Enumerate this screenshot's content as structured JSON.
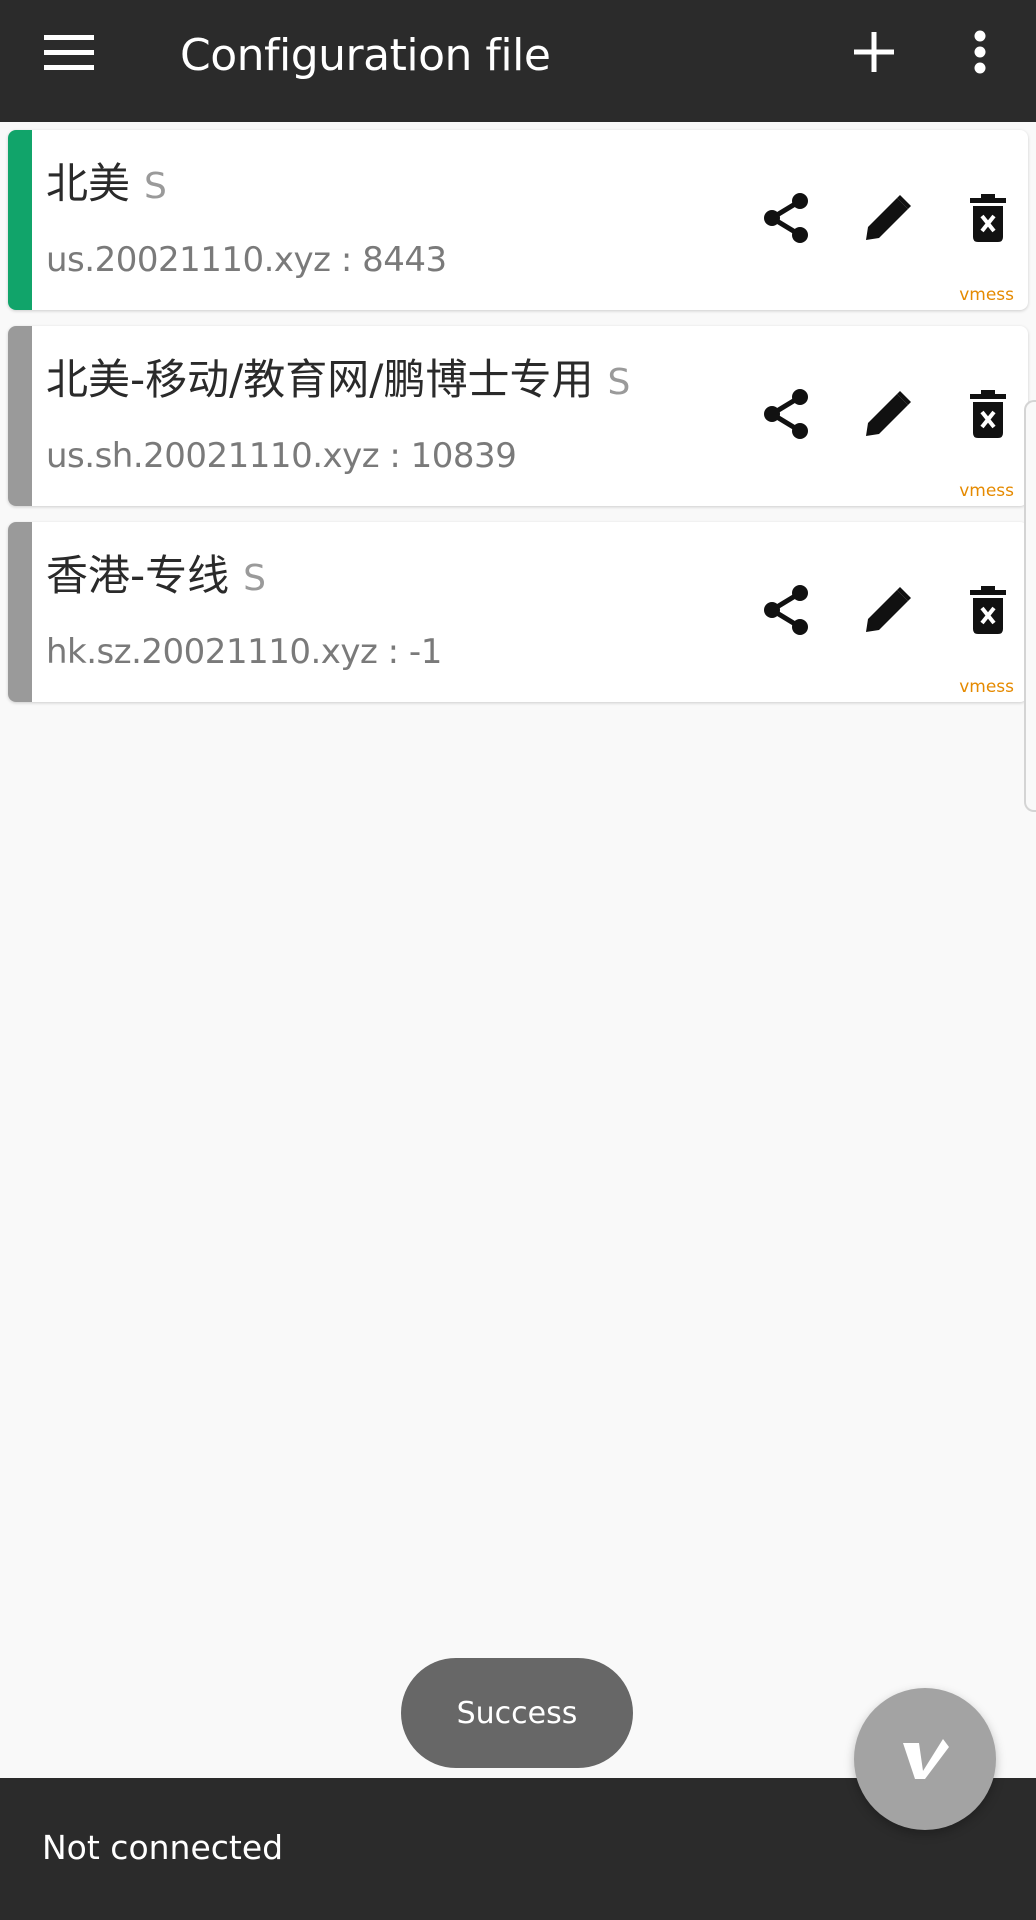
{
  "app_bar": {
    "title": "Configuration file",
    "icons": {
      "menu": "menu-icon",
      "add": "add-icon",
      "more": "more-vert-icon"
    }
  },
  "servers": [
    {
      "name": "北美",
      "suffix": "S",
      "address": "us.20021110.xyz : 8443",
      "protocol": "vmess",
      "selected": true,
      "stripe_color": "#11a46a"
    },
    {
      "name": "北美-移动/教育网/鹏博士专用",
      "suffix": "S",
      "address": "us.sh.20021110.xyz : 10839",
      "protocol": "vmess",
      "selected": false,
      "stripe_color": "#9a9a9a"
    },
    {
      "name": "香港-专线",
      "suffix": "S",
      "address": "hk.sz.20021110.xyz : -1",
      "protocol": "vmess",
      "selected": false,
      "stripe_color": "#9a9a9a"
    }
  ],
  "toast": {
    "text": "Success"
  },
  "status_bar": {
    "text": "Not connected"
  },
  "fab": {
    "icon": "v-logo-icon"
  },
  "colors": {
    "app_bar_bg": "#2b2b2b",
    "background": "#f9f9f9",
    "protocol_label": "#e58a00",
    "selected_stripe": "#11a46a",
    "unselected_stripe": "#9a9a9a"
  }
}
